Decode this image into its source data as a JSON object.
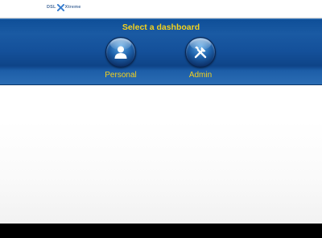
{
  "header": {
    "logo_text_left": "DSL",
    "logo_text_right": "Xtreme"
  },
  "banner": {
    "title": "Select a dashboard"
  },
  "dashboards": [
    {
      "label": "Personal",
      "icon": "person-icon"
    },
    {
      "label": "Admin",
      "icon": "tools-icon"
    }
  ],
  "colors": {
    "banner_blue": "#14509a",
    "label_yellow": "#f5d21c",
    "footer_black": "#000000"
  }
}
